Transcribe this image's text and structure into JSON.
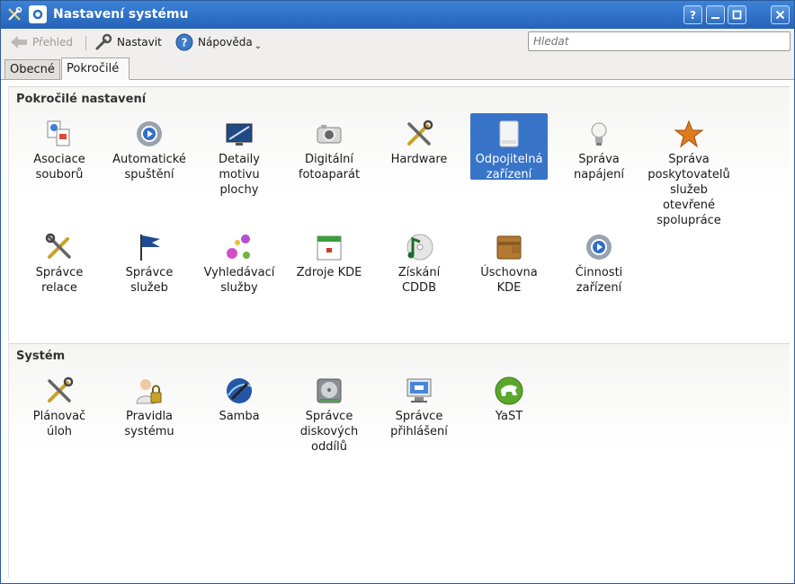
{
  "window": {
    "title": "Nastavení systému"
  },
  "titlebar_buttons": [
    "?",
    "_",
    "□",
    "✕"
  ],
  "toolbar": {
    "overview": "Přehled",
    "configure": "Nastavit",
    "help": "Nápověda"
  },
  "search": {
    "placeholder": "Hledat"
  },
  "tabs": [
    {
      "label": "Obecné"
    },
    {
      "label": "Pokročilé"
    }
  ],
  "sections": {
    "advanced": {
      "title": "Pokročilé nastavení",
      "items": [
        {
          "label": "Asociace\nsouborů",
          "icon": "file-association-icon"
        },
        {
          "label": "Automatické\nspuštění",
          "icon": "autostart-icon"
        },
        {
          "label": "Detaily\nmotivu\nplochy",
          "icon": "desktop-theme-icon"
        },
        {
          "label": "Digitální\nfotoaparát",
          "icon": "camera-icon"
        },
        {
          "label": "Hardware",
          "icon": "hardware-tools-icon"
        },
        {
          "label": "Odpojitelná\nzařízení",
          "icon": "removable-drive-icon"
        },
        {
          "label": "Správa\nnapájení",
          "icon": "lightbulb-icon"
        },
        {
          "label": "Správa\nposkytovatelů\nslužeb\notevřené\nspolupráce",
          "icon": "star-icon"
        },
        {
          "label": "Správce\nrelace",
          "icon": "session-tools-icon"
        },
        {
          "label": "Správce\nslužeb",
          "icon": "flag-icon"
        },
        {
          "label": "Vyhledávací\nslužby",
          "icon": "discovery-icon"
        },
        {
          "label": "Zdroje KDE",
          "icon": "calendar-icon"
        },
        {
          "label": "Získání\nCDDB",
          "icon": "music-cd-icon"
        },
        {
          "label": "Úschovna\nKDE",
          "icon": "wallet-icon"
        },
        {
          "label": "Činnosti\nzařízení",
          "icon": "device-actions-icon"
        }
      ]
    },
    "system": {
      "title": "Systém",
      "items": [
        {
          "label": "Plánovač\núloh",
          "icon": "scheduler-tools-icon"
        },
        {
          "label": "Pravidla\nsystému",
          "icon": "user-lock-icon"
        },
        {
          "label": "Samba",
          "icon": "samba-icon"
        },
        {
          "label": "Správce\ndiskových\noddílů",
          "icon": "disk-partition-icon"
        },
        {
          "label": "Správce\npřihlášení",
          "icon": "login-manager-icon"
        },
        {
          "label": "YaST",
          "icon": "yast-icon"
        }
      ]
    }
  },
  "colors": {
    "titlebar": "#2d6cc0",
    "selection": "#3874c8"
  }
}
